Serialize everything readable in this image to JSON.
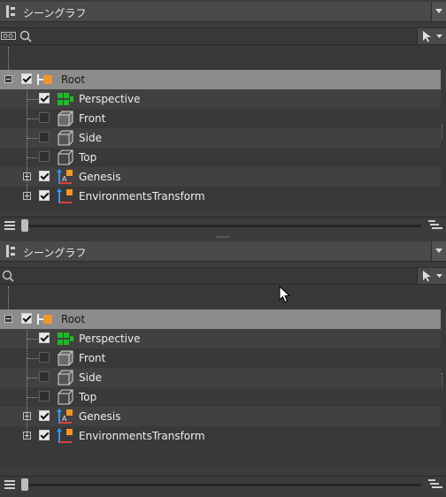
{
  "panel_title": "シーングラフ",
  "search": {
    "placeholder": "",
    "value": ""
  },
  "tree": {
    "root_label": "Root",
    "items": [
      {
        "label": "Perspective",
        "checked": true,
        "icon": "perspective-camera-icon"
      },
      {
        "label": "Front",
        "checked": false,
        "icon": "ortho-camera-icon"
      },
      {
        "label": "Side",
        "checked": false,
        "icon": "ortho-camera-icon"
      },
      {
        "label": "Top",
        "checked": false,
        "icon": "ortho-camera-icon"
      },
      {
        "label": "Genesis",
        "checked": true,
        "icon": "transform-node-icon"
      },
      {
        "label": "EnvironmentsTransform",
        "checked": true,
        "icon": "transform-node-icon"
      }
    ]
  },
  "colors": {
    "accent_orange": "#f0962a",
    "green_node": "#27b32f",
    "blue_axis": "#2f9bff",
    "red_axis": "#e0413a"
  }
}
